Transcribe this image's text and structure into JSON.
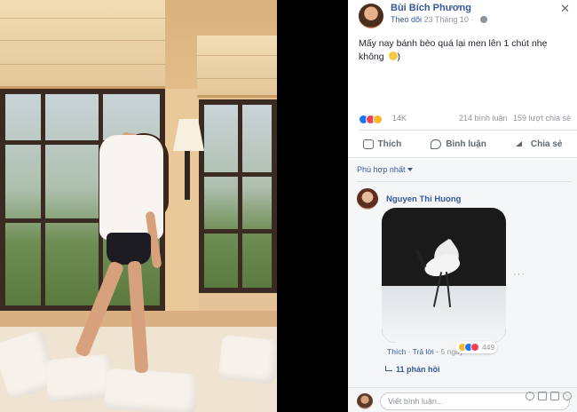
{
  "post": {
    "author": "Bùi Bích Phương",
    "follow_label": "Theo dõi",
    "time": "· 23 Tháng 10 ·",
    "close": "✕",
    "text": "Mấy nay bánh bèo quá lại men lên 1 chút nhẹ không",
    "text_end": ")"
  },
  "stats": {
    "reactions": "14K",
    "comments": "214 bình luận",
    "shares": "159 lượt chia sẻ"
  },
  "actions": {
    "like": "Thích",
    "comment": "Bình luận",
    "share": "Chia sẻ"
  },
  "comments_section": {
    "sort_label": "Phù hợp nhất"
  },
  "comment": {
    "author": "Nguyen Thi Huong",
    "like": "Thích",
    "reply": "Trả lời",
    "time": "5 ngày",
    "reactions": "449",
    "replies": "11 phản hồi",
    "more": "···"
  },
  "composer": {
    "placeholder": "Viết bình luận..."
  }
}
